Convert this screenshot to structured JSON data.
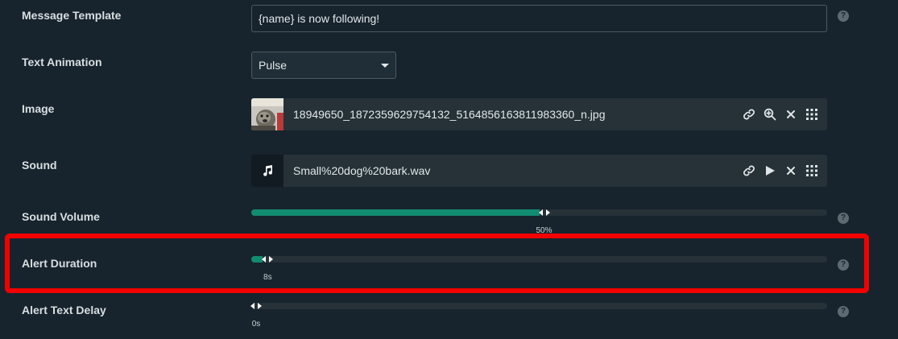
{
  "rows": {
    "message_template": {
      "label": "Message Template",
      "value": "{name} is now following!"
    },
    "text_animation": {
      "label": "Text Animation",
      "selected": "Pulse"
    },
    "image": {
      "label": "Image",
      "filename": "18949650_1872359629754132_5164856163811983360_n.jpg"
    },
    "sound": {
      "label": "Sound",
      "filename": "Small%20dog%20bark.wav"
    },
    "sound_volume": {
      "label": "Sound Volume",
      "value_text": "50%",
      "value": 0.5
    },
    "alert_duration": {
      "label": "Alert Duration",
      "value_text": "8s",
      "value": 0.02
    },
    "alert_text_delay": {
      "label": "Alert Text Delay",
      "value_text": "0s",
      "value": 0
    }
  },
  "help_glyph": "?",
  "colors": {
    "accent": "#128c70",
    "highlight": "#f20000",
    "background": "#17242d"
  },
  "icons": {
    "image_actions": [
      "link-icon",
      "zoom-in-icon",
      "close-icon",
      "grid-icon"
    ],
    "sound_actions": [
      "link-icon",
      "play-icon",
      "close-icon",
      "grid-icon"
    ]
  }
}
